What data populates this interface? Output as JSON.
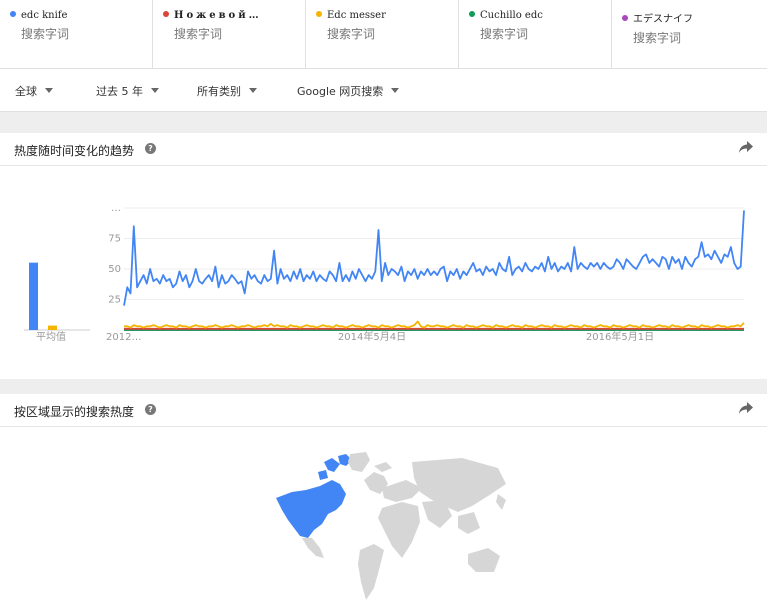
{
  "terms": [
    {
      "name": "edc knife",
      "sub": "搜索字词",
      "color": "#4285f4"
    },
    {
      "name": "Ножевой…",
      "sub": "搜索字词",
      "color": "#db4437"
    },
    {
      "name": "Edc messer",
      "sub": "搜索字词",
      "color": "#f4b400"
    },
    {
      "name": "Cuchillo edc",
      "sub": "搜索字词",
      "color": "#0f9d58"
    },
    {
      "name": "エデスナイフ",
      "sub": "搜索字词",
      "color": "#ab47bc"
    }
  ],
  "filters": {
    "region": "全球",
    "time": "过去 5 年",
    "category": "所有类别",
    "property": "Google 网页搜索"
  },
  "trend": {
    "title": "热度随时间变化的趋势",
    "help": "?"
  },
  "region_section": {
    "title": "按区域显示的搜索热度",
    "help": "?"
  },
  "chart_data": {
    "type": "line",
    "ylabels": [
      "…",
      "75",
      "50",
      "25"
    ],
    "ylim": [
      0,
      100
    ],
    "xlabels": [
      "2012…",
      "2014年5月4日",
      "2016年5月1日"
    ],
    "average_label": "平均值",
    "average": [
      {
        "name": "edc knife",
        "value": 46,
        "color": "#4285f4"
      },
      {
        "name": "Edc messer",
        "value": 3,
        "color": "#f4b400"
      }
    ],
    "series": [
      {
        "name": "edc knife",
        "color": "#4285f4",
        "values": [
          20,
          35,
          30,
          85,
          35,
          40,
          45,
          38,
          50,
          40,
          42,
          38,
          45,
          40,
          42,
          35,
          38,
          48,
          40,
          45,
          35,
          40,
          50,
          40,
          38,
          42,
          45,
          40,
          52,
          35,
          45,
          38,
          40,
          45,
          42,
          38,
          40,
          30,
          48,
          42,
          45,
          40,
          38,
          45,
          40,
          42,
          65,
          38,
          50,
          42,
          45,
          40,
          48,
          42,
          50,
          40,
          45,
          42,
          48,
          40,
          45,
          42,
          40,
          48,
          45,
          40,
          55,
          40,
          45,
          40,
          48,
          42,
          50,
          45,
          40,
          45,
          42,
          48,
          82,
          40,
          55,
          45,
          50,
          48,
          45,
          52,
          40,
          48,
          45,
          50,
          42,
          48,
          45,
          50,
          45,
          48,
          45,
          50,
          52,
          40,
          48,
          45,
          50,
          42,
          48,
          45,
          50,
          55,
          48,
          50,
          45,
          52,
          48,
          50,
          45,
          55,
          50,
          48,
          60,
          45,
          50,
          52,
          48,
          55,
          50,
          48,
          52,
          50,
          55,
          48,
          60,
          50,
          55,
          48,
          52,
          50,
          55,
          48,
          68,
          50,
          55,
          52,
          50,
          55,
          52,
          55,
          50,
          55,
          52,
          50,
          52,
          58,
          55,
          50,
          58,
          55,
          52,
          50,
          55,
          60,
          62,
          55,
          58,
          55,
          52,
          60,
          58,
          50,
          60,
          55,
          58,
          50,
          60,
          55,
          52,
          58,
          60,
          72,
          60,
          62,
          58,
          65,
          60,
          55,
          62,
          60,
          68,
          55,
          50,
          52,
          98
        ]
      },
      {
        "name": "Edc messer",
        "color": "#f4b400",
        "values": [
          3,
          3,
          2,
          4,
          3,
          3,
          2,
          3,
          3,
          4,
          3,
          2,
          3,
          4,
          3,
          3,
          2,
          4,
          3,
          3,
          2,
          3,
          4,
          3,
          3,
          2,
          3,
          3,
          4,
          3,
          2,
          3,
          3,
          4,
          3,
          2,
          3,
          3,
          4,
          3,
          2,
          3,
          3,
          4,
          3,
          5,
          3,
          4,
          3,
          3,
          2,
          4,
          3,
          3,
          2,
          3,
          4,
          3,
          3,
          2,
          3,
          4,
          3,
          3,
          2,
          4,
          3,
          3,
          2,
          3,
          4,
          3,
          3,
          2,
          3,
          4,
          3,
          3,
          2,
          4,
          3,
          3,
          2,
          3,
          4,
          3,
          3,
          2,
          3,
          4,
          7,
          3,
          2,
          4,
          3,
          3,
          4,
          3,
          3,
          2,
          3,
          4,
          3,
          3,
          2,
          4,
          3,
          3,
          2,
          3,
          4,
          3,
          3,
          2,
          4,
          3,
          3,
          2,
          3,
          4,
          3,
          3,
          2,
          4,
          3,
          3,
          2,
          3,
          4,
          3,
          3,
          2,
          4,
          3,
          3,
          2,
          3,
          4,
          3,
          3,
          2,
          4,
          3,
          3,
          2,
          3,
          4,
          3,
          3,
          2,
          4,
          3,
          3,
          2,
          3,
          4,
          3,
          3,
          2,
          4,
          3,
          3,
          2,
          3,
          4,
          3,
          3,
          2,
          4,
          3,
          3,
          2,
          3,
          4,
          3,
          3,
          2,
          4,
          3,
          3,
          2,
          3,
          4,
          3,
          3,
          2,
          3,
          3,
          4,
          3,
          6
        ]
      },
      {
        "name": "Ножевой…",
        "color": "#db4437",
        "values": [
          1,
          1,
          1,
          1,
          1,
          1,
          1,
          1,
          1,
          1,
          1,
          1,
          1,
          1,
          1,
          1,
          1,
          1,
          1,
          1,
          1,
          1,
          1,
          1,
          1,
          1,
          1,
          1,
          1,
          1,
          1,
          1,
          1,
          1,
          1,
          1,
          1,
          1,
          1,
          1,
          1,
          1,
          1,
          1,
          1,
          1,
          1,
          1,
          1,
          1,
          1,
          1,
          1,
          1,
          1,
          1,
          1,
          1,
          1,
          1,
          1,
          1,
          1,
          1,
          1,
          1,
          1,
          1,
          1,
          1,
          1,
          1,
          1,
          1,
          1,
          1,
          1,
          1,
          1,
          1,
          1,
          1,
          1,
          1,
          1,
          1,
          1,
          1,
          1,
          1,
          1,
          1,
          1,
          1,
          1,
          1,
          1,
          1,
          1,
          1,
          1,
          1,
          1,
          1,
          1,
          1,
          1,
          1,
          1,
          1,
          1,
          1,
          1,
          1,
          1,
          1,
          1,
          1,
          1,
          1,
          1,
          1,
          1,
          1,
          1,
          1,
          1,
          1,
          1,
          1,
          1,
          1,
          1,
          1,
          1,
          1,
          1,
          1,
          1,
          1,
          1,
          1,
          1,
          1,
          1,
          1,
          1,
          1,
          1,
          1,
          1,
          1,
          1,
          1,
          1,
          1,
          1,
          1,
          1,
          1,
          1,
          1,
          1,
          1,
          1,
          1,
          1,
          1,
          1,
          1,
          1,
          1,
          1,
          1,
          1,
          1,
          1,
          1,
          1,
          1,
          1,
          1,
          1,
          1,
          1,
          1,
          1,
          1,
          1,
          1,
          1,
          1,
          1,
          1,
          1
        ]
      },
      {
        "name": "Cuchillo edc",
        "color": "#0f9d58",
        "values": [
          0,
          0,
          0,
          0,
          0,
          0,
          0,
          0,
          0,
          0,
          0,
          0,
          0,
          0,
          0,
          0,
          0,
          0,
          0,
          0,
          0,
          0,
          0,
          0,
          0,
          0,
          0,
          0,
          0,
          0,
          0,
          0,
          0,
          0,
          0,
          0,
          0,
          0,
          0,
          0,
          0,
          0,
          0,
          0,
          0,
          0,
          0,
          0,
          0,
          0,
          0,
          0,
          0,
          0,
          0,
          0,
          0,
          0,
          0,
          0,
          0,
          0,
          0,
          0,
          0,
          0,
          0,
          0,
          0,
          0,
          0,
          0,
          0,
          0,
          0,
          0,
          0,
          0,
          0,
          0,
          0,
          0,
          0,
          0,
          0,
          0,
          0,
          0,
          0,
          0,
          0,
          0,
          0,
          0,
          0,
          0,
          0,
          0,
          0,
          0,
          0,
          0,
          0,
          0,
          0,
          0,
          0,
          0,
          0,
          0,
          0,
          0,
          0,
          0,
          0,
          0,
          0,
          0,
          0,
          0,
          0,
          0,
          0,
          0,
          0,
          0,
          0,
          0,
          0,
          0,
          0,
          0,
          0,
          0,
          0,
          0,
          0,
          0,
          0,
          0,
          0,
          0,
          0,
          0,
          0,
          0,
          0,
          0,
          0,
          0,
          0,
          0,
          0,
          0,
          0,
          0,
          0,
          0,
          0,
          0,
          0,
          0,
          0,
          0,
          0,
          0,
          0,
          0,
          0,
          0,
          0,
          0,
          0,
          0,
          0,
          0,
          0,
          0,
          0,
          0,
          0,
          0,
          0,
          0,
          0,
          0,
          0,
          0,
          0,
          0,
          0,
          0,
          0,
          0,
          0
        ]
      },
      {
        "name": "エデスナイフ",
        "color": "#ab47bc",
        "values": [
          0,
          0,
          0,
          0,
          0,
          0,
          0,
          0,
          0,
          0,
          0,
          0,
          0,
          0,
          0,
          0,
          0,
          0,
          0,
          0,
          0,
          0,
          0,
          0,
          0,
          0,
          0,
          0,
          0,
          0,
          0,
          0,
          0,
          0,
          0,
          0,
          0,
          0,
          0,
          0,
          0,
          0,
          0,
          0,
          0,
          0,
          0,
          0,
          0,
          0,
          0,
          0,
          0,
          0,
          0,
          0,
          0,
          0,
          0,
          0,
          0,
          0,
          0,
          0,
          0,
          0,
          0,
          0,
          0,
          0,
          0,
          0,
          0,
          0,
          0,
          0,
          0,
          0,
          0,
          0,
          0,
          0,
          0,
          0,
          0,
          0,
          0,
          0,
          0,
          0,
          0,
          0,
          0,
          0,
          0,
          0,
          0,
          0,
          0,
          0,
          0,
          0,
          0,
          0,
          0,
          0,
          0,
          0,
          0,
          0,
          0,
          0,
          0,
          0,
          0,
          0,
          0,
          0,
          0,
          0,
          0,
          0,
          0,
          0,
          0,
          0,
          0,
          0,
          0,
          0,
          0,
          0,
          0,
          0,
          0,
          0,
          0,
          0,
          0,
          0,
          0,
          0,
          0,
          0,
          0,
          0,
          0,
          0,
          0,
          0,
          0,
          0,
          0,
          0,
          0,
          0,
          0,
          0,
          0,
          0,
          0,
          0,
          0,
          0,
          0,
          0,
          0,
          0,
          0,
          0,
          0,
          0,
          0,
          0,
          0,
          0,
          0,
          0,
          0,
          0,
          0,
          0,
          0,
          0,
          0,
          0,
          0,
          0,
          0,
          0,
          0,
          0,
          0,
          0,
          0
        ]
      }
    ]
  },
  "map": {
    "highlight_color": "#4285f4",
    "base_color": "#d6d6d6"
  }
}
